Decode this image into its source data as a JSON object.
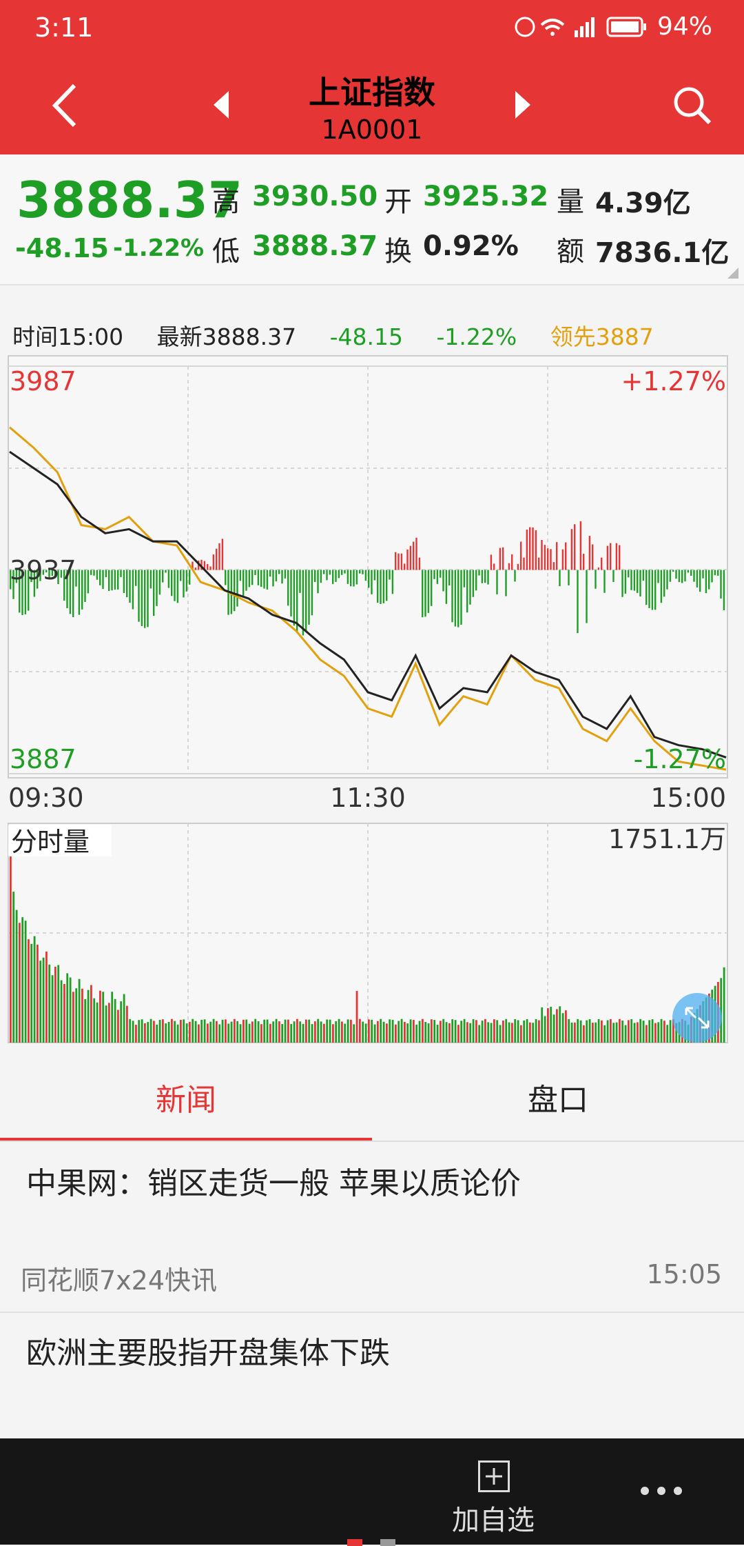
{
  "status": {
    "time": "3:11",
    "battery": "94%"
  },
  "header": {
    "title": "上证指数",
    "subtitle": "1A0001"
  },
  "quote": {
    "price": "3888.37",
    "change": "-48.15",
    "change_pct": "-1.22%",
    "high_label": "高",
    "high": "3930.50",
    "low_label": "低",
    "low": "3888.37",
    "open_label": "开",
    "open": "3925.32",
    "turnover_label": "换",
    "turnover": "0.92%",
    "volume_label": "量",
    "volume": "4.39亿",
    "amount_label": "额",
    "amount": "7836.1亿"
  },
  "info": {
    "time": "时间15:00",
    "latest": "最新3888.37",
    "change": "-48.15",
    "change_pct": "-1.22%",
    "leading": "领先3887"
  },
  "chart": {
    "y_top": "3987",
    "y_mid": "3937",
    "y_bottom": "3887",
    "pct_top": "+1.27%",
    "pct_bottom": "-1.27%",
    "x_start": "09:30",
    "x_mid": "11:30",
    "x_end": "15:00",
    "volume_title": "分时量",
    "volume_max": "1751.1万",
    "colors": {
      "price": "#222222",
      "leading": "#e3a00d",
      "up": "#e53534",
      "down": "#1e9e24"
    }
  },
  "tabs": {
    "news": "新闻",
    "pankou": "盘口"
  },
  "news": [
    {
      "title": "中果网：销区走货一般 苹果以质论价",
      "source": "同花顺7x24快讯",
      "time": "15:05"
    },
    {
      "title": "欧洲主要股指开盘集体下跌"
    }
  ],
  "bottom": {
    "add_label": "加自选"
  },
  "chart_data": {
    "type": "line",
    "x": [
      "09:30",
      "11:30",
      "15:00"
    ],
    "ylim": [
      3887,
      3987
    ],
    "series": [
      {
        "values": [
          3966,
          3962,
          3958,
          3950,
          3946,
          3947,
          3944,
          3944,
          3938,
          3932,
          3930,
          3926,
          3924,
          3919,
          3915,
          3907,
          3905,
          3916,
          3903,
          3908,
          3907,
          3916,
          3912,
          3910,
          3901,
          3898,
          3906,
          3896,
          3894,
          3893,
          3891
        ]
      },
      {
        "values": [
          3972,
          3967,
          3961,
          3948,
          3947,
          3950,
          3944,
          3943,
          3934,
          3932,
          3929,
          3927,
          3922,
          3915,
          3911,
          3903,
          3901,
          3914,
          3899,
          3906,
          3904,
          3916,
          3910,
          3908,
          3898,
          3895,
          3903,
          3895,
          3890,
          3889,
          3888
        ]
      }
    ]
  }
}
